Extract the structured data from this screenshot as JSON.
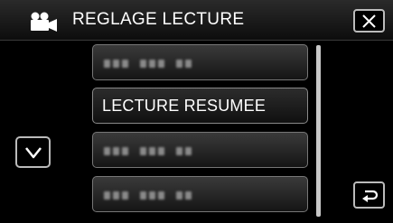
{
  "header": {
    "title": "REGLAGE LECTURE",
    "mode_icon": "video-camera-icon",
    "close_icon": "close-icon"
  },
  "menu": {
    "items": [
      {
        "label": "",
        "blurred": true
      },
      {
        "label": "LECTURE RESUMEE",
        "blurred": false,
        "selected": true
      },
      {
        "label": "",
        "blurred": true
      },
      {
        "label": "",
        "blurred": true
      }
    ]
  },
  "controls": {
    "scroll_down_icon": "chevron-down-icon",
    "back_icon": "return-arrow-icon"
  },
  "colors": {
    "background": "#000000",
    "text": "#ffffff",
    "button_border": "#bbbbbb"
  }
}
